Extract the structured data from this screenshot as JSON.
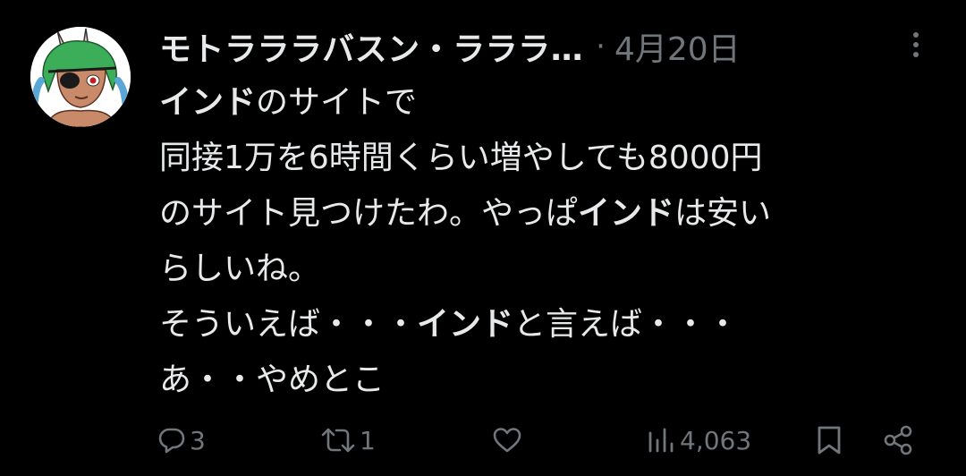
{
  "tweet": {
    "display_name": "モトラララバスン・ラララ…",
    "separator": "·",
    "date": "4月20日",
    "body_segments": [
      {
        "text": "インド",
        "bold": true
      },
      {
        "text": "のサイトで\n同接1万を6時間くらい増やしても8000円\nのサイト見つけたわ。やっぱ",
        "bold": false
      },
      {
        "text": "インド",
        "bold": true
      },
      {
        "text": "は安い\nらしいね。\nそういえば・・・",
        "bold": false
      },
      {
        "text": "インド",
        "bold": true
      },
      {
        "text": "と言えば・・・\nあ・・やめとこ",
        "bold": false
      }
    ]
  },
  "actions": {
    "reply_count": "3",
    "retweet_count": "1",
    "views_count": "4,063"
  },
  "icons": {
    "avatar": "anime-character-avatar",
    "more": "more-vertical-icon",
    "reply": "reply-icon",
    "retweet": "retweet-icon",
    "like": "heart-icon",
    "views": "views-chart-icon",
    "bookmark": "bookmark-icon",
    "share": "share-icon"
  },
  "colors": {
    "background": "#000000",
    "text": "#e7e9ea",
    "secondary": "#71767b"
  }
}
